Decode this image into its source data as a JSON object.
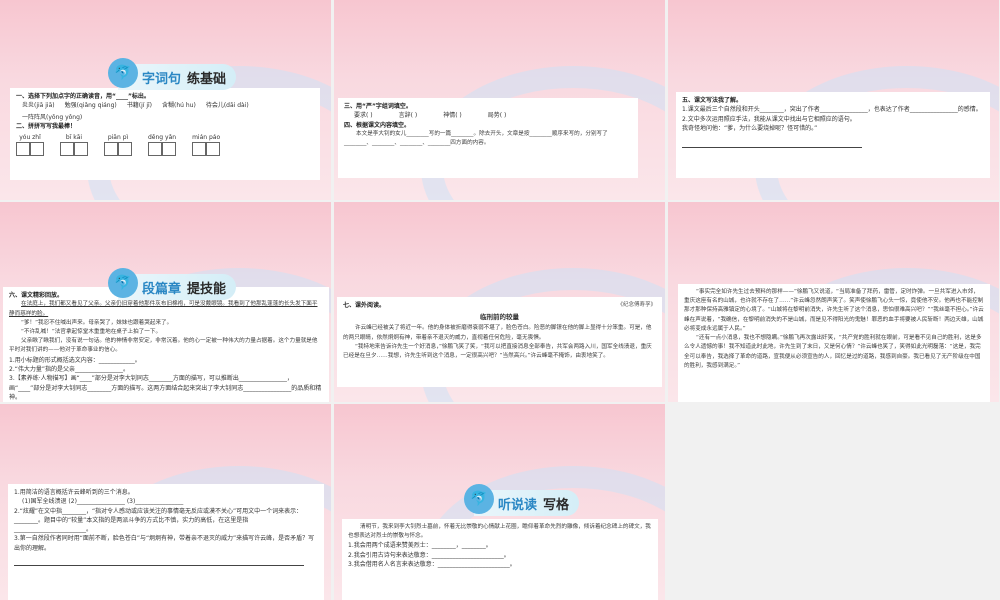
{
  "slide1": {
    "badge": {
      "t1": "字词句",
      "t2": "练基础"
    },
    "q1": "一、选择下列加点字的正确读音，用“____”标出。",
    "q1_items": [
      "炎炎(jiā jiā)",
      "勉强(qiǎng qiáng)",
      "书籍(jí jī)",
      "含糊(hú hu)",
      "待会儿(dāi dài)",
      "一阵阵风(yōng yǒng)"
    ],
    "q2": "二、拼拼写写我最棒！",
    "pinyin": [
      {
        "py": "yóu zhǐ"
      },
      {
        "py": "bī kāi"
      },
      {
        "py": "piān pì"
      },
      {
        "py": "dēng yǎn"
      },
      {
        "py": "mián páo"
      }
    ]
  },
  "slide2": {
    "q3": "三、用“严”字组词填空。",
    "q3_items": [
      "要求(    )",
      "言辞(    )",
      "神情(    )",
      "局势(    )"
    ],
    "q4": "四、根据课文内容填空。",
    "q4_text": "本文是李大钊的女儿________写的一篇________。除去开头，文章是按________顺序来写的，分别写了________、________、________、________四方面的内容。"
  },
  "slide3": {
    "q5": "五、课文写法我了解。",
    "items": [
      "1.课文最后三个自然段和开头________，突出了作者________________，也表达了作者________________的感情。",
      "2.文中多次运用照应手法，我能从课文中找出与它相照应的语句。",
      "我奇怪地问他：“爹，为什么要烧掉呢？怪可惜的。”"
    ]
  },
  "slide4": {
    "badge": {
      "t1": "段篇章",
      "t2": "提技能"
    },
    "q6": "六、课文精彩回放。",
    "passage": [
      "在法庭上，我们都又看见了父亲。父亲仍旧穿着他那件灰布旧棉袍，可是没戴眼镜。我看到了他那乱蓬蓬的长头发下面平静而慈祥的脸。",
      "“爹！”我忍不住喊出声来。母亲哭了，妹妹也跟着哭起来了。",
      "“不许乱喊！”法官拿起惊堂木重重地在桌子上拍了一下。",
      "父亲瞅了瞅我们，没有说一句话。他的神情非常安定，非常沉着。他的心一定被一种伟大的力量占据着。这个力量就是他平时对我们讲的——他对于革命事业的信心。"
    ],
    "qs": [
      "1.用小标题的形式概括选文内容：____________。",
      "2.“伟大力量”指的是父亲________________。",
      "3.【素养练·人物描写】画“____”部分是对李大钊同志________方面的描写，可以推断出________________，画“____”部分是对李大钊同志________方面的描写。这两方面结合起来突出了李大钊同志________________的品质和精神。"
    ]
  },
  "slide5": {
    "q7": "七、课外阅读。",
    "note": "《纪念傅寿孚》",
    "title": "临刑前的较量",
    "passage": [
      "许云峰已经被关了将近一年。他的身体被折磨得衰弱不堪了，脸色苍白。险恶的脚镣在他的脚上显得十分笨重。可是，他的两只眼睛，依然炯炯有神，带着亲不退灭的威力，直视着任何危险，毫无畏惧。",
      "“我特地来告诉许先生一个好消息，”徐鹏飞笑了笑，“我可以把直接消息全部奉告，共军会两路入川，国军全线溃退，重庆已经是在旦夕……我想，许先生听到这个消息，一定很高兴吧？”当然高兴。”许云峰毫不掩饰，由衷地笑了。"
    ]
  },
  "slide6": {
    "passage": [
      "“事实完全如许先生过去预料的那样——”徐鹏飞又说道，“当局准备了拜药，雷管，定时炸弹。一旦共军进入市郊，重庆这座有名的山城，也许就不存在了……”许云峰忽然朗声笑了。笑声使徐鹏飞心头一惊，竟使他不安。他再也不能控制那才那种保持高雅镇定的心境了。“山城将在黎明前消失，许先生听了这个消息，思怕很难高兴吧？”“我丝毫不担心。”许云峰在声说着，“我确信，在黎明前消失的不是山城，而是见不得阳光的鬼魅！罪恶的血手将要被人民斩断！两边天雄，山城必将变成永远属于人民。”",
      "“还有一点小消息，我也不想隐瞒。”徐鹏飞再次露出奸笑，“共产党的胜利就在眼前，可是看不见自己的胜利，这是多么令人遗憾的事！我不知道此时此地，许先生到了末日，又是何心情？”许云峰也笑了，笑得如此光明磊落：“这是，我完全可以奉告，我选择了革命的道路，宣我便从必须宣告的人，回忆是过的道路，我感到自豪。我已看见了无产阶级在中国的胜利，我感到满足。”"
    ]
  },
  "slide7": {
    "qs": [
      "1.用简洁的语言概括许云峰听到的三个消息。",
      "(1)国军全线溃退    (2)________________    (3)________________",
      "2.“炫耀”在文中指________，“指对令人感动或应该关注的事情毫无反应或漠不关心”可用文中一个词来表示：________。题目中的“较量”本文指的是两派斗争的方式比不慎，实力的高低，在这里是指________________________。",
      "3.第一自然段作者同时用“面前不断，脸色苍白”与“炯炯有神，带着亲不退灭的威力”来描写许云峰，是否矛盾？写出你的理解。"
    ]
  },
  "slide8": {
    "badge": {
      "t1": "听说读",
      "t2": "写格"
    },
    "intro": "清明节，我来到李大钊烈士墓前，怀着无比崇敬的心情献上花圈，瞻仰着革命先烈的雕像，倾诉着纪念碑上的碑文，我也想表达对烈士的崇敬与怀念。",
    "qs": [
      "1.我会用两个成语来赞美烈士：________，________。",
      "2.我会引用古诗句来表达敬意：________________________。",
      "3.我会借用名人名言来表达敬意：________________________。"
    ]
  }
}
